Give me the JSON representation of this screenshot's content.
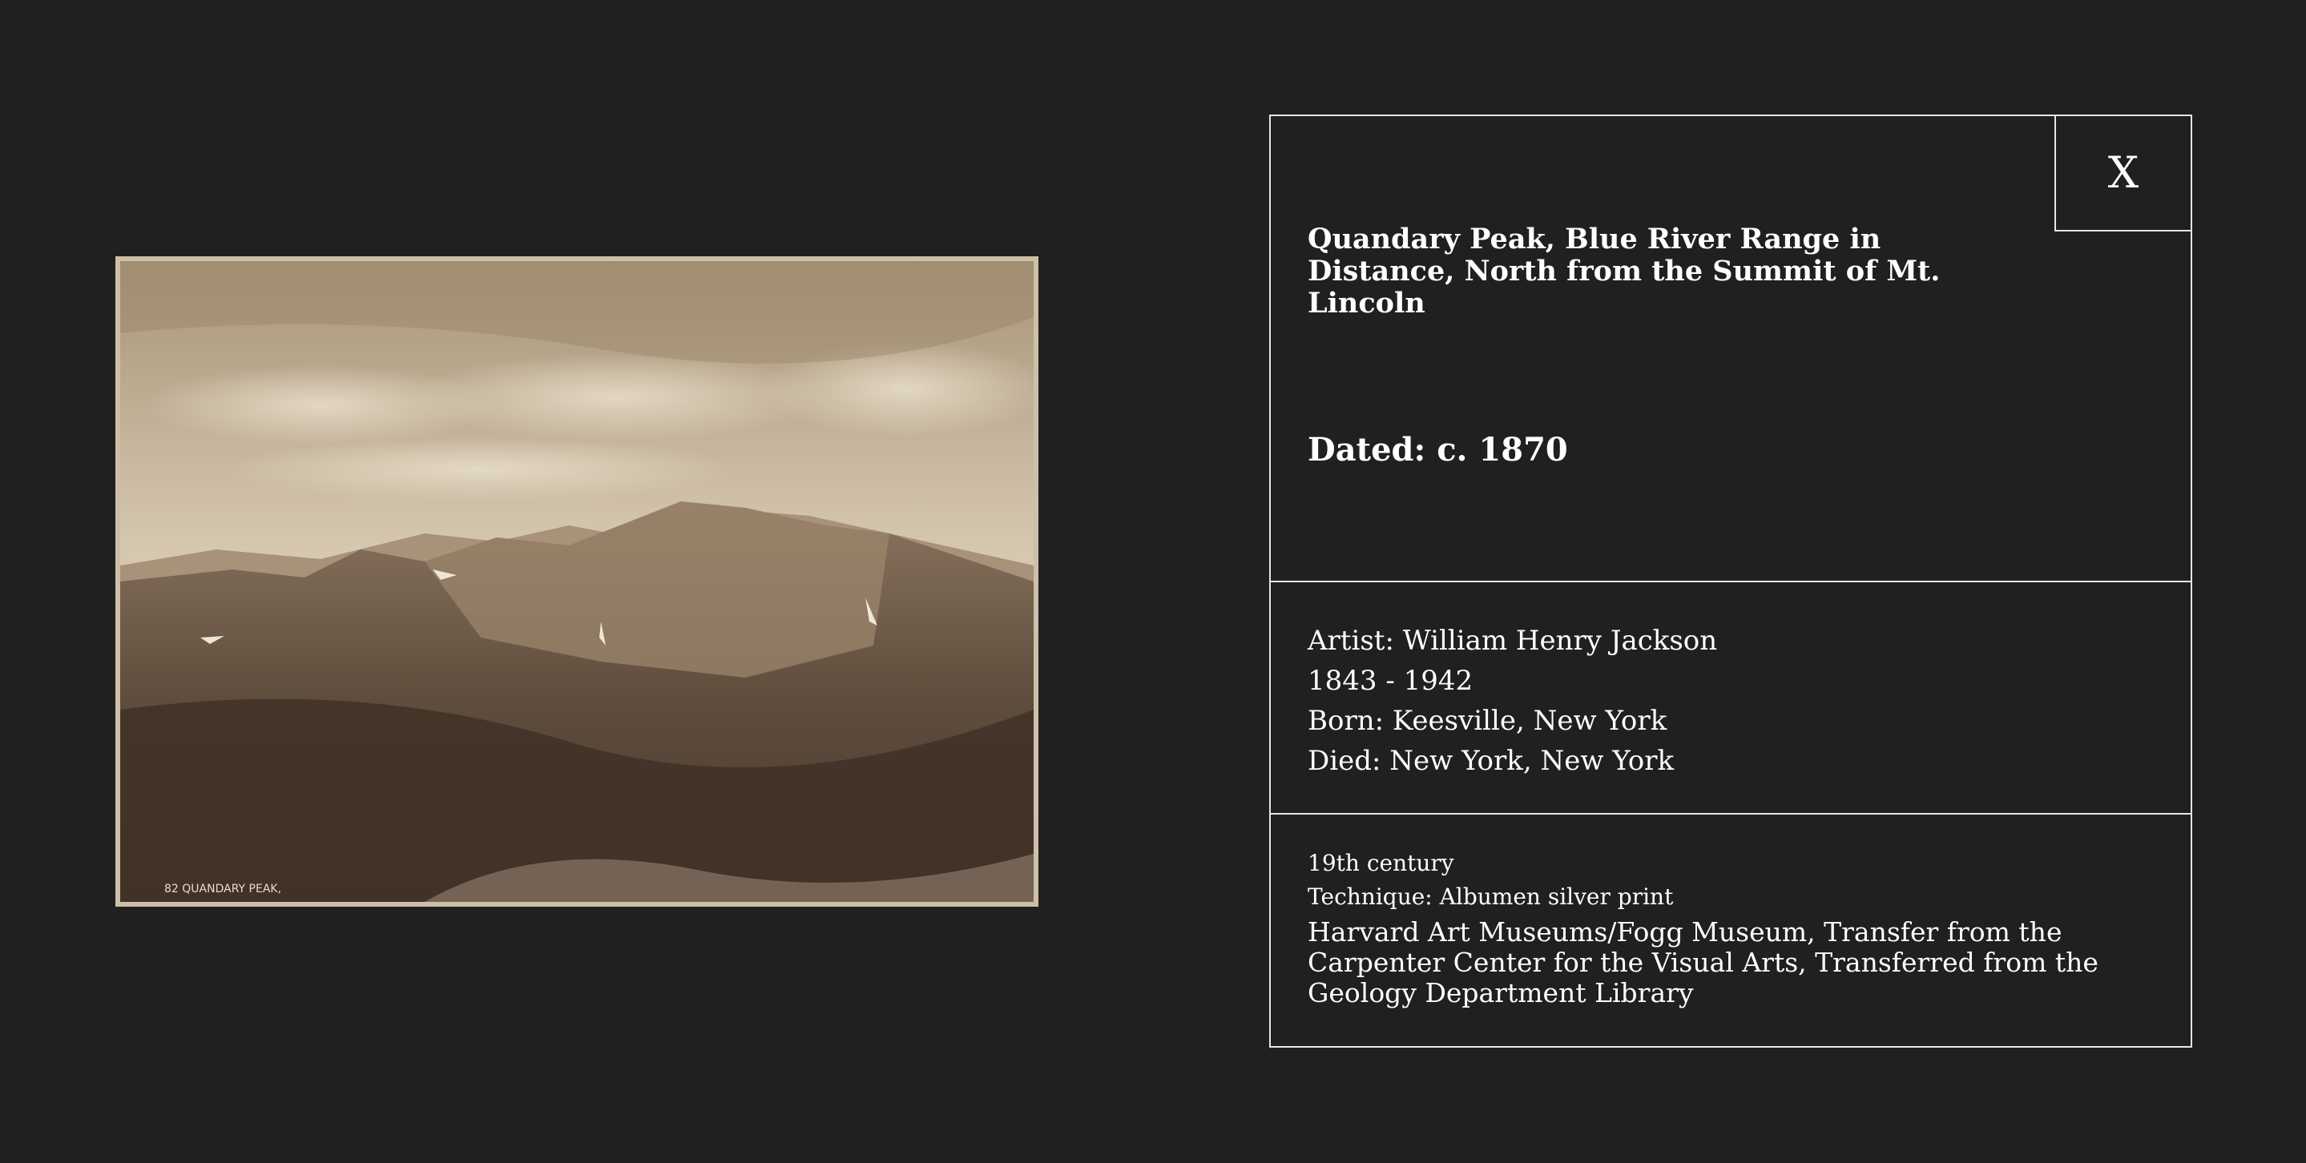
{
  "artwork": {
    "title": "Quandary Peak, Blue River Range in Distance, North from the Summit of Mt. Lincoln",
    "dated": "Dated: c. 1870",
    "photo_caption": "82 QUANDARY PEAK,"
  },
  "artist": {
    "name": "Artist: William Henry Jackson",
    "lifespan": "1843 - 1942",
    "born": "Born: Keesville, New York",
    "died": "Died: New York, New York"
  },
  "details": {
    "century": "19th century",
    "technique": "Technique: Albumen silver print",
    "credit": "Harvard Art Museums/Fogg Museum, Transfer from the Carpenter Center for the Visual Arts, Transferred from the Geology Department Library"
  },
  "controls": {
    "close_label": "X"
  }
}
